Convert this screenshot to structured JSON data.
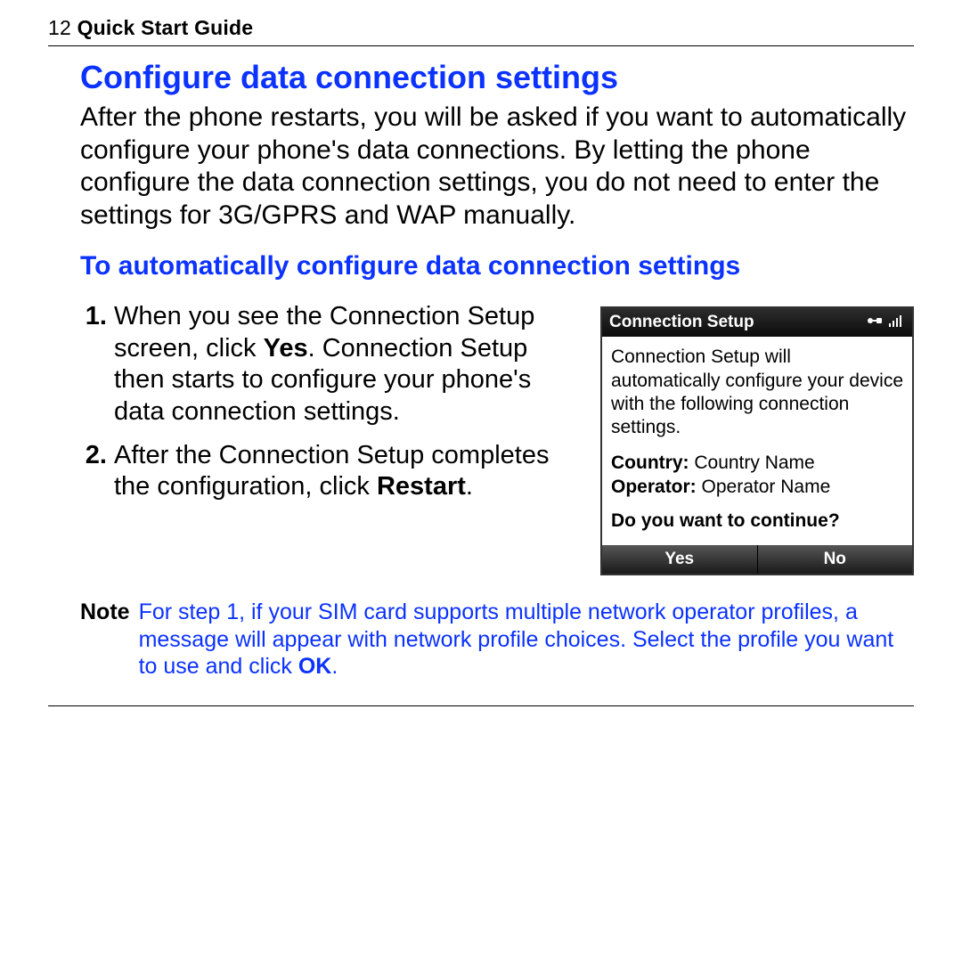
{
  "header": {
    "page_no": "12",
    "guide": "Quick Start Guide"
  },
  "section": {
    "title": "Configure data connection settings",
    "intro": "After the phone restarts, you will be asked if you want to automatically configure your phone's data connections. By letting the phone configure the data connection settings, you do not need to enter the settings for 3G/GPRS and WAP manually.",
    "sub_title": "To automatically configure data connection settings",
    "steps": {
      "s1_a": "When you see the Connection Setup screen, click ",
      "s1_bold": "Yes",
      "s1_b": ". Connection Setup then starts to configure your phone's data connection settings.",
      "s2_a": "After the Connection Setup completes the configuration, click ",
      "s2_bold": "Restart",
      "s2_b": "."
    }
  },
  "phone": {
    "title": "Connection Setup",
    "desc": "Connection Setup will automatically configure your device with the following connection settings.",
    "country_label": "Country:",
    "country_value": "Country Name",
    "operator_label": "Operator:",
    "operator_value": "Operator Name",
    "ask": "Do you want to continue?",
    "soft_left": "Yes",
    "soft_right": "No"
  },
  "note": {
    "label": "Note",
    "body_a": "For step 1, if your SIM card supports multiple network operator profiles, a message will appear with network profile choices. Select the profile you want to use and click ",
    "body_bold": "OK",
    "body_b": "."
  }
}
